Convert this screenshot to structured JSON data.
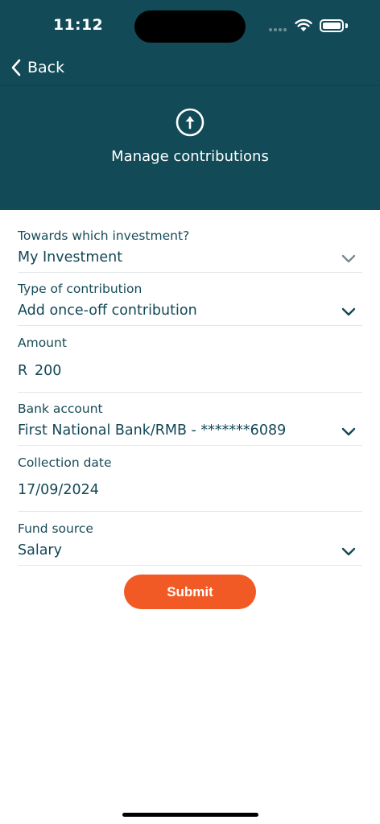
{
  "status_bar": {
    "time": "11:12"
  },
  "nav": {
    "back_label": "Back"
  },
  "header": {
    "title": "Manage contributions",
    "icon": "arrow-up-circle-icon"
  },
  "form": {
    "investment": {
      "label": "Towards which investment?",
      "value": "My Investment"
    },
    "contribution_type": {
      "label": "Type of contribution",
      "value": "Add once-off contribution"
    },
    "amount": {
      "label": "Amount",
      "currency": "R",
      "value": "200"
    },
    "bank_account": {
      "label": "Bank account",
      "value": "First National Bank/RMB - *******6089"
    },
    "collection_date": {
      "label": "Collection date",
      "value": "17/09/2024"
    },
    "fund_source": {
      "label": "Fund source",
      "value": "Salary"
    }
  },
  "actions": {
    "submit_label": "Submit"
  },
  "colors": {
    "header_bg": "#124b57",
    "accent": "#f15a24",
    "text": "#124755"
  }
}
